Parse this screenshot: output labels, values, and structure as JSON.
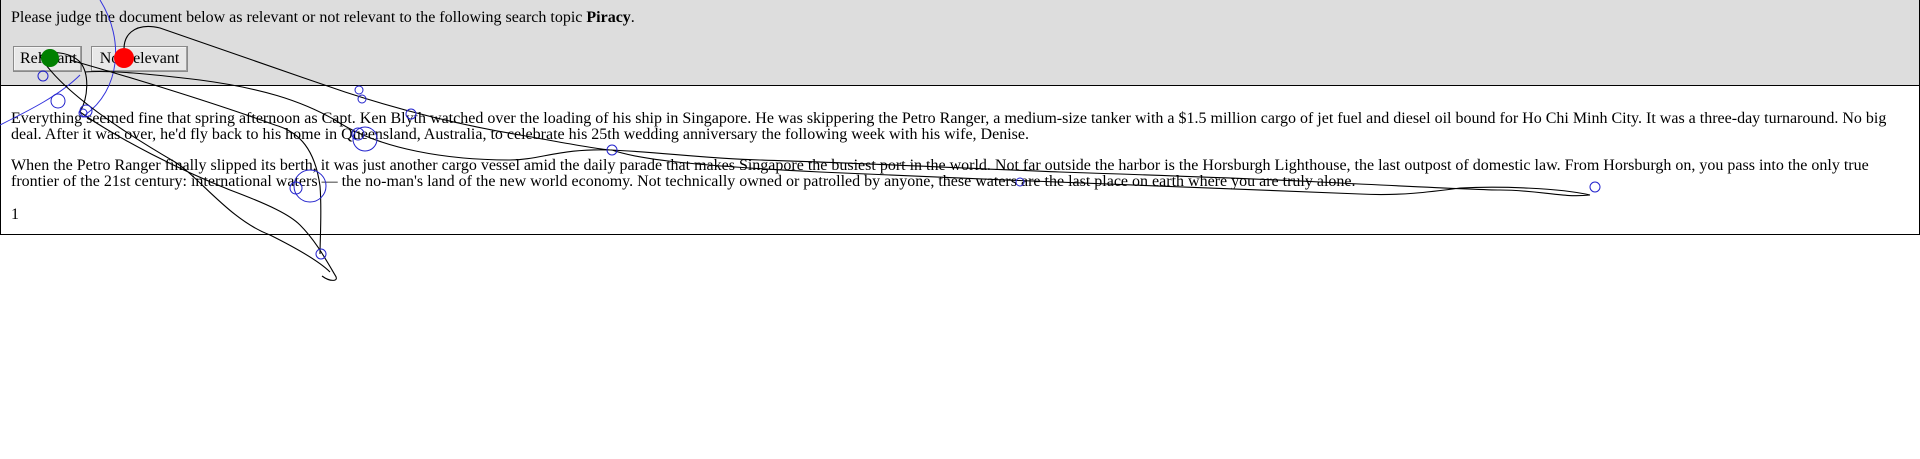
{
  "prompt": {
    "text": "Please judge the document below as relevant or not relevant to the following search topic ",
    "topic": "Piracy",
    "end": "."
  },
  "buttons": {
    "relevant": "Relevant",
    "not_relevant": "Not relevant"
  },
  "document": {
    "paragraphs": [
      "Everything seemed fine that spring afternoon as Capt. Ken Blyth watched over the loading of his ship in Singapore. He was skippering the Petro Ranger, a medium-size tanker with a $1.5 million cargo of jet fuel and diesel oil bound for Ho Chi Minh City. It was a three-day turnaround. No big deal. After it was over, he'd fly back to his home in Queensland, Australia, to celebrate his 25th wedding anniversary the following week with his wife, Denise.",
      "When the Petro Ranger finally slipped its berth, it was just another cargo vessel amid the daily parade that makes Singapore the busiest port in the world. Not far outside the harbor is the Horsburgh Lighthouse, the last outpost of domestic law. From Horsburgh on, you pass into the only true frontier of the 21st century: international waters — the no-man's land of the new world economy. Not technically owned or patrolled by anyone, these waters are the last place on earth where you are truly alone."
    ],
    "page_number": "1"
  },
  "colors": {
    "header_bg": "#dddddd",
    "relevant_marker": "#008000",
    "not_relevant_marker": "#ff0000",
    "gaze_circle": "#0000cc",
    "mouse_trail": "#000000"
  }
}
